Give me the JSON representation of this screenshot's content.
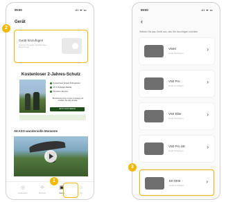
{
  "left_phone": {
    "status": {
      "time": "09:00",
      "icons": "ıll ᯤ ▭"
    },
    "title": "Gerät",
    "add_card": {
      "title": "Gerät hinzufügen",
      "subtitle": "Nehmen Sie jeden gewünschten Moment auf"
    },
    "promo": {
      "headline": "Kostenloser 2-Jahres-Schutz",
      "features": [
        "Kostenloser Ersatz & Reparatur",
        "10 % Zubehör-Rabatt",
        "Premium-Service"
      ],
      "note": "Bewerbenie kann unsere Umfrage und erhalten Sie alle Vorteile.",
      "button": "JETZT AKTIVIEREN"
    },
    "section_title": "AKASO wundervolle Momente",
    "tabs": [
      {
        "label": "Entdecken",
        "icon": "compass-icon"
      },
      {
        "label": "Moment",
        "icon": "plus-icon"
      },
      {
        "label": "Gerät",
        "icon": "camera-icon"
      },
      {
        "label": "Ich",
        "icon": "person-icon"
      }
    ]
  },
  "right_phone": {
    "status": {
      "time": "09:00",
      "icons": "ıll ᯤ ▭"
    },
    "back": "‹",
    "instruction": "Wählen Sie das Gerät aus, das Sie hinzufügen möchten",
    "devices": [
      {
        "name": "V50X",
        "hint": "Gerät hinzufügen"
      },
      {
        "name": "V50 Pro",
        "hint": "Gerät hinzufügen"
      },
      {
        "name": "V50 Elite",
        "hint": "Gerät hinzufügen"
      },
      {
        "name": "V50 Pro SE",
        "hint": "Gerät hinzufügen"
      },
      {
        "name": "EK7000",
        "hint": "Gerät hinzufügen"
      }
    ]
  },
  "badges": [
    "1",
    "2",
    "3"
  ],
  "colors": {
    "accent": "#f2b800",
    "promo_green": "#1e4d1c"
  }
}
